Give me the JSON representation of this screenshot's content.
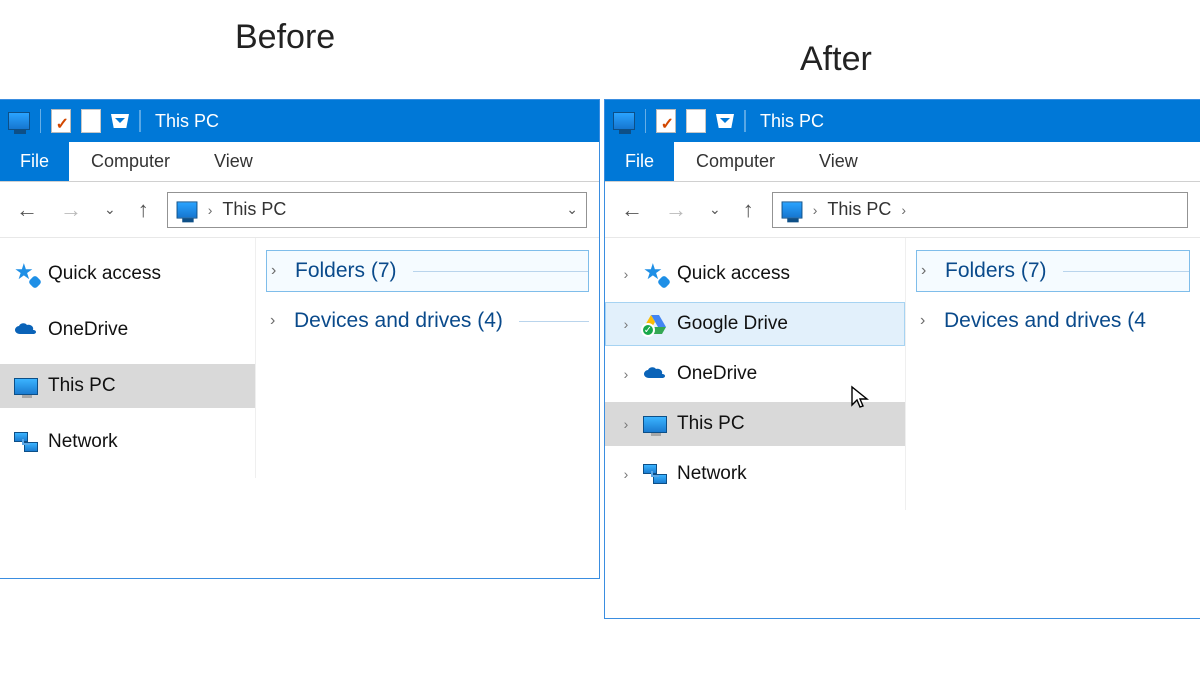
{
  "headings": {
    "before": "Before",
    "after": "After"
  },
  "window_title": "This PC",
  "ribbon": {
    "file": "File",
    "computer": "Computer",
    "view": "View"
  },
  "address": {
    "crumb": "This PC"
  },
  "nav": {
    "quick_access": "Quick access",
    "google_drive": "Google Drive",
    "onedrive": "OneDrive",
    "this_pc": "This PC",
    "network": "Network"
  },
  "sections": {
    "folders": "Folders (7)",
    "devices": "Devices and drives (4)",
    "devices_truncated": "Devices and drives (4"
  }
}
